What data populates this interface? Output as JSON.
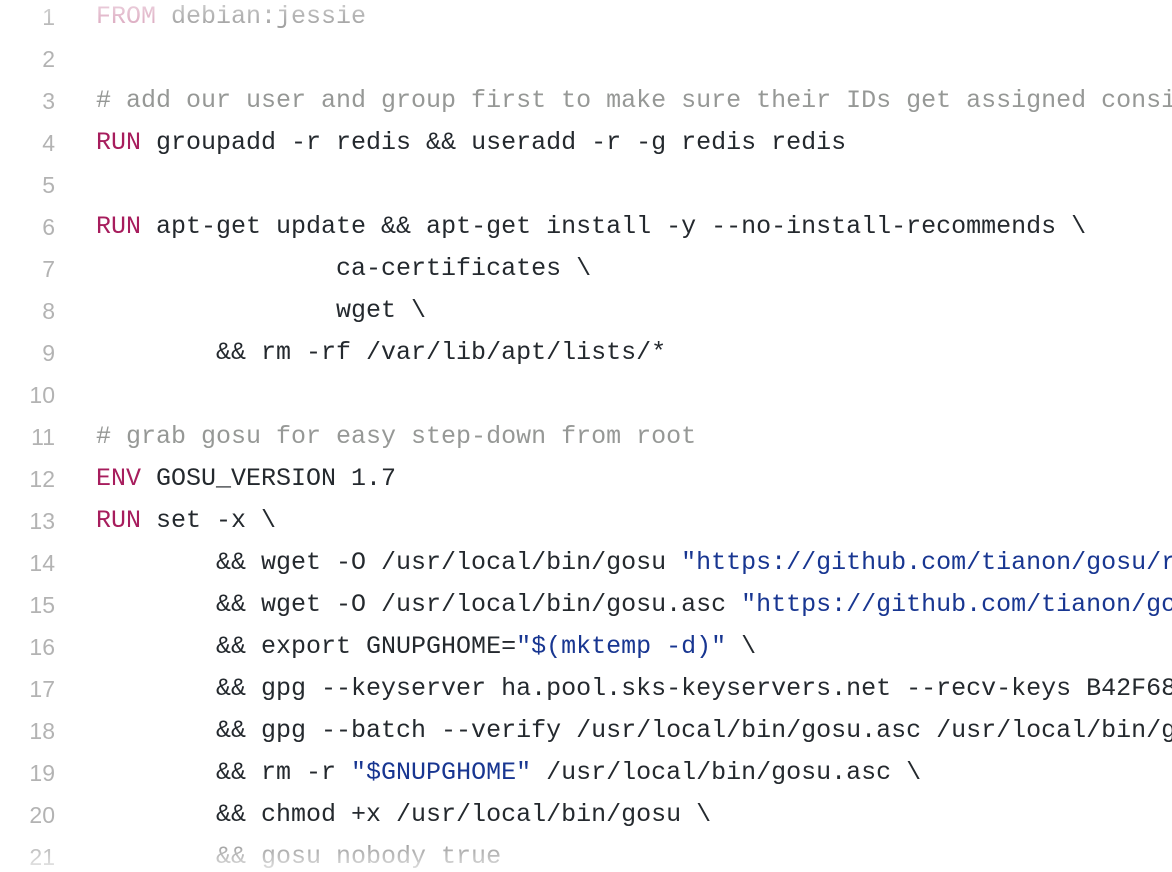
{
  "code": {
    "lines": [
      {
        "n": "1",
        "tokens": [
          {
            "t": "FROM",
            "c": "kw-dim"
          },
          {
            "t": " debian:jessie",
            "c": "dim"
          }
        ]
      },
      {
        "n": "2",
        "tokens": []
      },
      {
        "n": "3",
        "tokens": [
          {
            "t": "# add our user and group first to make sure their IDs get assigned consi",
            "c": "comment"
          }
        ]
      },
      {
        "n": "4",
        "tokens": [
          {
            "t": "RUN",
            "c": "kw"
          },
          {
            "t": " groupadd -r redis && useradd -r -g redis redis",
            "c": "plain"
          }
        ]
      },
      {
        "n": "5",
        "tokens": []
      },
      {
        "n": "6",
        "tokens": [
          {
            "t": "RUN",
            "c": "kw"
          },
          {
            "t": " apt-get update && apt-get install -y --no-install-recommends \\",
            "c": "plain"
          }
        ]
      },
      {
        "n": "7",
        "tokens": [
          {
            "t": "                ca-certificates \\",
            "c": "plain"
          }
        ]
      },
      {
        "n": "8",
        "tokens": [
          {
            "t": "                wget \\",
            "c": "plain"
          }
        ]
      },
      {
        "n": "9",
        "tokens": [
          {
            "t": "        && rm -rf /var/lib/apt/lists/*",
            "c": "plain"
          }
        ]
      },
      {
        "n": "10",
        "tokens": []
      },
      {
        "n": "11",
        "tokens": [
          {
            "t": "# grab gosu for easy step-down from root",
            "c": "comment"
          }
        ]
      },
      {
        "n": "12",
        "tokens": [
          {
            "t": "ENV",
            "c": "kw"
          },
          {
            "t": " GOSU_VERSION 1.7",
            "c": "plain"
          }
        ]
      },
      {
        "n": "13",
        "tokens": [
          {
            "t": "RUN",
            "c": "kw"
          },
          {
            "t": " set -x \\",
            "c": "plain"
          }
        ]
      },
      {
        "n": "14",
        "tokens": [
          {
            "t": "        && wget -O /usr/local/bin/gosu ",
            "c": "plain"
          },
          {
            "t": "\"https://github.com/tianon/gosu/r",
            "c": "str"
          }
        ]
      },
      {
        "n": "15",
        "tokens": [
          {
            "t": "        && wget -O /usr/local/bin/gosu.asc ",
            "c": "plain"
          },
          {
            "t": "\"https://github.com/tianon/go",
            "c": "str"
          }
        ]
      },
      {
        "n": "16",
        "tokens": [
          {
            "t": "        && export GNUPGHOME=",
            "c": "plain"
          },
          {
            "t": "\"$(mktemp -d)\"",
            "c": "str"
          },
          {
            "t": " \\",
            "c": "plain"
          }
        ]
      },
      {
        "n": "17",
        "tokens": [
          {
            "t": "        && gpg --keyserver ha.pool.sks-keyservers.net --recv-keys B42F68",
            "c": "plain"
          }
        ]
      },
      {
        "n": "18",
        "tokens": [
          {
            "t": "        && gpg --batch --verify /usr/local/bin/gosu.asc /usr/local/bin/g",
            "c": "plain"
          }
        ]
      },
      {
        "n": "19",
        "tokens": [
          {
            "t": "        && rm -r ",
            "c": "plain"
          },
          {
            "t": "\"$GNUPGHOME\"",
            "c": "str"
          },
          {
            "t": " /usr/local/bin/gosu.asc \\",
            "c": "plain"
          }
        ]
      },
      {
        "n": "20",
        "tokens": [
          {
            "t": "        && chmod +x /usr/local/bin/gosu \\",
            "c": "plain"
          }
        ]
      },
      {
        "n": "21",
        "tokens": [
          {
            "t": "        && gosu nobody true",
            "c": "dim"
          }
        ]
      }
    ]
  },
  "colors": {
    "keyword": "#a71d5d",
    "string": "#183691",
    "comment": "#969896",
    "text": "#24292e",
    "line_number": "#b3b3b3",
    "background": "#ffffff"
  }
}
